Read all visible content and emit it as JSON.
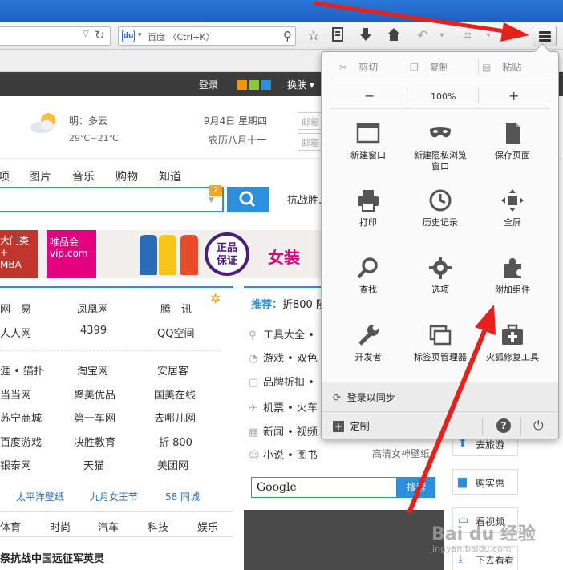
{
  "browser": {
    "search_placeholder": "百度 〈Ctrl+K〉",
    "search_engine_badge": "du"
  },
  "site_bar": {
    "login": "登录",
    "skin": "换肤 ▾",
    "swatch_colors": [
      "#f39800",
      "#8cc63f",
      "#2b8fdb"
    ]
  },
  "weather": {
    "forecast": "明：多云",
    "temp": "29℃~21℃",
    "date": "9月4日 星期四",
    "lunar": "农历八月十一",
    "mailbox1": "邮箱",
    "mailbox2": "邮箱"
  },
  "categories": [
    "项",
    "图片",
    "音乐",
    "购物",
    "知道"
  ],
  "search": {
    "badge": "2",
    "hot": "抗战胜..."
  },
  "banner": {
    "mba": "大门类\n+\nMBA",
    "vip_line1": "唯品会",
    "vip_line2": "vip.com",
    "seal": "正品\n保证",
    "women": "女装"
  },
  "sites": [
    [
      "网　易",
      "凤凰网",
      "腾　讯"
    ],
    [
      "人人网",
      "4399",
      "QQ空间"
    ],
    [
      "涯 • 猫扑",
      "淘宝网",
      "安居客"
    ],
    [
      "当当网",
      "聚美优品",
      "国美在线"
    ],
    [
      "苏宁商城",
      "第一车网",
      "去哪儿网"
    ],
    [
      "百度游戏",
      "决胜教育",
      "折 800"
    ],
    [
      "银泰网",
      "天猫",
      "美团网"
    ]
  ],
  "links_row": [
    "太平洋壁纸",
    "九月女王节",
    "58 同城"
  ],
  "bottom_tabs": [
    "体育",
    "时尚",
    "汽车",
    "科技",
    "娱乐"
  ],
  "headline": "祭抗战中国远征军英灵",
  "recommend": {
    "label": "推荐：",
    "head": "折800 陨",
    "items": [
      "工具大全 •",
      "游戏 • 双色",
      "品牌折扣 •",
      "机票 • 火车",
      "新闻 • 视频",
      "小说 • 图书"
    ],
    "side_text": "高清女神壁纸"
  },
  "google": {
    "logo": "Google",
    "button": "搜索"
  },
  "right_buttons": [
    "去旅游",
    "购实惠",
    "看视频",
    "下去看看"
  ],
  "menu_panel": {
    "cut": "剪切",
    "copy": "复制",
    "paste": "粘贴",
    "zoom_out": "−",
    "zoom": "100%",
    "zoom_in": "+",
    "items": [
      {
        "label": "新建窗口",
        "icon": "window-icon"
      },
      {
        "label": "新建隐私浏览\n窗口",
        "icon": "mask-icon"
      },
      {
        "label": "保存页面",
        "icon": "page-icon"
      },
      {
        "label": "打印",
        "icon": "printer-icon"
      },
      {
        "label": "历史记录",
        "icon": "clock-icon"
      },
      {
        "label": "全屏",
        "icon": "fullscreen-icon"
      },
      {
        "label": "查找",
        "icon": "magnifier-icon"
      },
      {
        "label": "选项",
        "icon": "gear-icon"
      },
      {
        "label": "附加组件",
        "icon": "puzzle-icon"
      },
      {
        "label": "开发者",
        "icon": "wrench-icon"
      },
      {
        "label": "标签页管理器",
        "icon": "tabs-icon"
      },
      {
        "label": "火狐修复工具",
        "icon": "medkit-icon"
      }
    ],
    "sign_in": "登录以同步",
    "customize": "定制"
  },
  "watermark": {
    "brand": "Bai du 经验",
    "url": "jingyan.baidu.com"
  },
  "colors": {
    "accent": "#2b8fdb",
    "arrow": "#e8201b",
    "titlebar": "#2b78d9"
  }
}
